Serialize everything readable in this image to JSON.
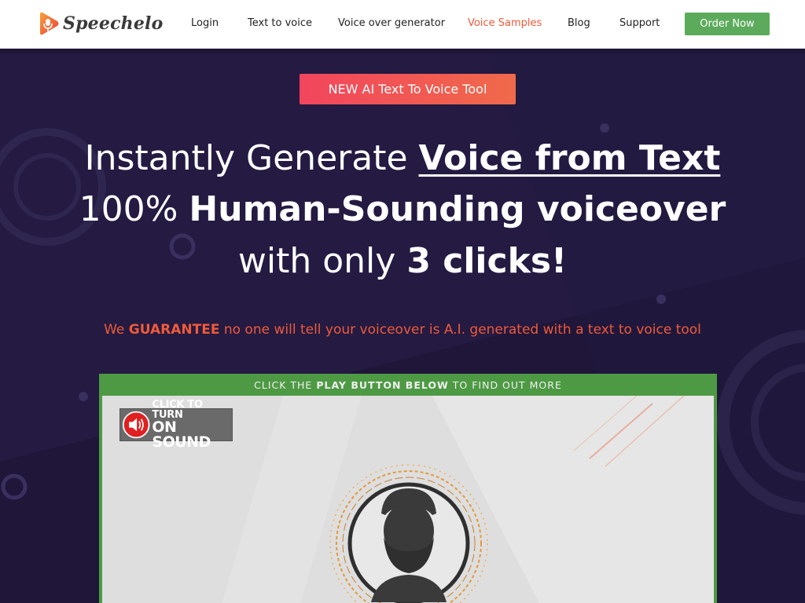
{
  "header": {
    "brand": "Speechelo",
    "nav": [
      {
        "label": "Login"
      },
      {
        "label": "Text to voice"
      },
      {
        "label": "Voice over generator"
      },
      {
        "label": "Voice Samples",
        "active": true
      },
      {
        "label": "Blog"
      },
      {
        "label": "Support"
      }
    ],
    "order_label": "Order Now"
  },
  "hero": {
    "badge": "NEW AI Text To Voice Tool",
    "line1_prefix": "Instantly Generate ",
    "line1_emph": "Voice from Text",
    "line2_prefix": "100% ",
    "line2_emph": "Human-Sounding voiceover",
    "line3_prefix": "with only ",
    "line3_emph": "3 clicks!",
    "guarantee_prefix": "We ",
    "guarantee_emph": "GUARANTEE",
    "guarantee_suffix": " no one will tell your voiceover is A.I. generated with a text to voice tool"
  },
  "video": {
    "caption_prefix": "CLICK THE ",
    "caption_emph": "PLAY BUTTON BELOW",
    "caption_suffix": " TO FIND OUT MORE",
    "sound_line1": "CLICK TO TURN",
    "sound_line2": "ON SOUND"
  },
  "colors": {
    "accent": "#f05a3a",
    "order_button": "#5cab5c",
    "hero_bg": "#1f1639",
    "video_frame": "#4e9a44"
  },
  "icons": [
    "speechelo-logo-icon",
    "speaker-icon",
    "avatar-icon"
  ]
}
